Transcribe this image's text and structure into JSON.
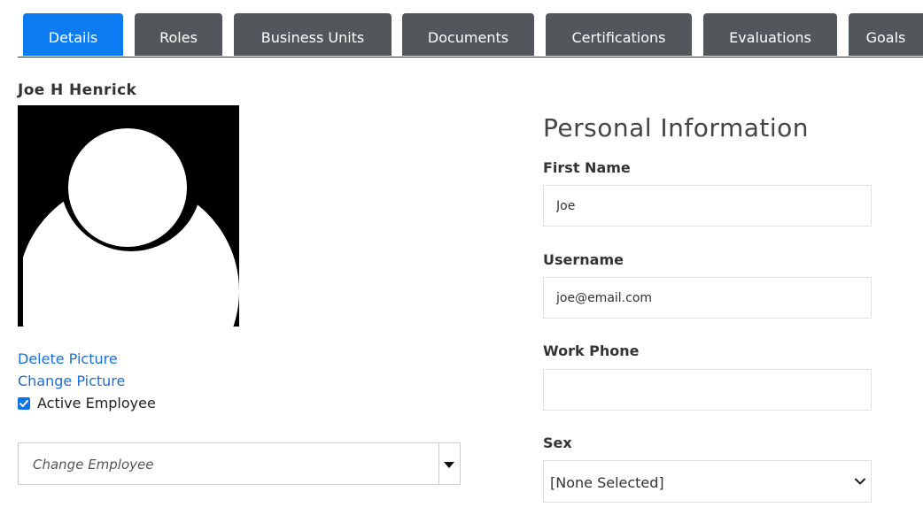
{
  "tabs": [
    {
      "label": "Details",
      "active": true
    },
    {
      "label": "Roles",
      "active": false
    },
    {
      "label": "Business Units",
      "active": false
    },
    {
      "label": "Documents",
      "active": false
    },
    {
      "label": "Certifications",
      "active": false
    },
    {
      "label": "Evaluations",
      "active": false
    },
    {
      "label": "Goals",
      "active": false
    }
  ],
  "employee": {
    "name": "Joe H Henrick",
    "delete_picture": "Delete Picture",
    "change_picture": "Change Picture",
    "active_label": "Active Employee",
    "active_checked": true,
    "change_employee_placeholder": "Change Employee"
  },
  "personal": {
    "title": "Personal Information",
    "first_name_label": "First Name",
    "first_name_value": "Joe",
    "username_label": "Username",
    "username_value": "joe@email.com",
    "work_phone_label": "Work Phone",
    "work_phone_value": "",
    "sex_label": "Sex",
    "sex_value": "[None Selected]"
  },
  "colors": {
    "tab_active": "#0d7cf2",
    "tab_inactive": "#53575b",
    "link": "#1a6fd8"
  },
  "icons": {
    "avatar": "default-user-silhouette",
    "combo_arrow": "caret-down-icon",
    "select_arrow": "chevron-down-icon",
    "checkbox": "checkmark-icon"
  }
}
